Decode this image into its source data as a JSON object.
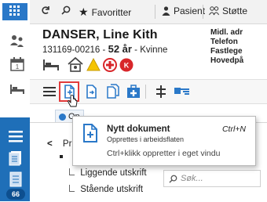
{
  "topbar": {
    "favoritter": "Favoritter",
    "pasient": "Pasient",
    "stotte": "Støtte"
  },
  "patient": {
    "name": "DANSER, Line Kith",
    "id": "131169-00216",
    "sep": "-",
    "age": "52 år",
    "gender": "- Kvinne"
  },
  "right_info": {
    "line1": "Midl. adr",
    "line2": "Telefon",
    "line3": "Fastlege",
    "line4": "Hovedpå"
  },
  "tab": {
    "label": "Op"
  },
  "tree": {
    "item1": "Pr",
    "item2": "Liggende utskrift",
    "item3": "Stående utskrift"
  },
  "search": {
    "placeholder": "Søk..."
  },
  "badge": {
    "count": "66"
  },
  "tooltip": {
    "title": "Nytt dokument",
    "shortcut": "Ctrl+N",
    "subtitle": "Opprettes i arbeidsflaten",
    "hint": "Ctrl+klikk oppretter i eget vindu"
  },
  "colors": {
    "accent_blue": "#2a78c8",
    "highlight_red": "#e23b3b",
    "left_panel_blue": "#1f6fb8"
  }
}
